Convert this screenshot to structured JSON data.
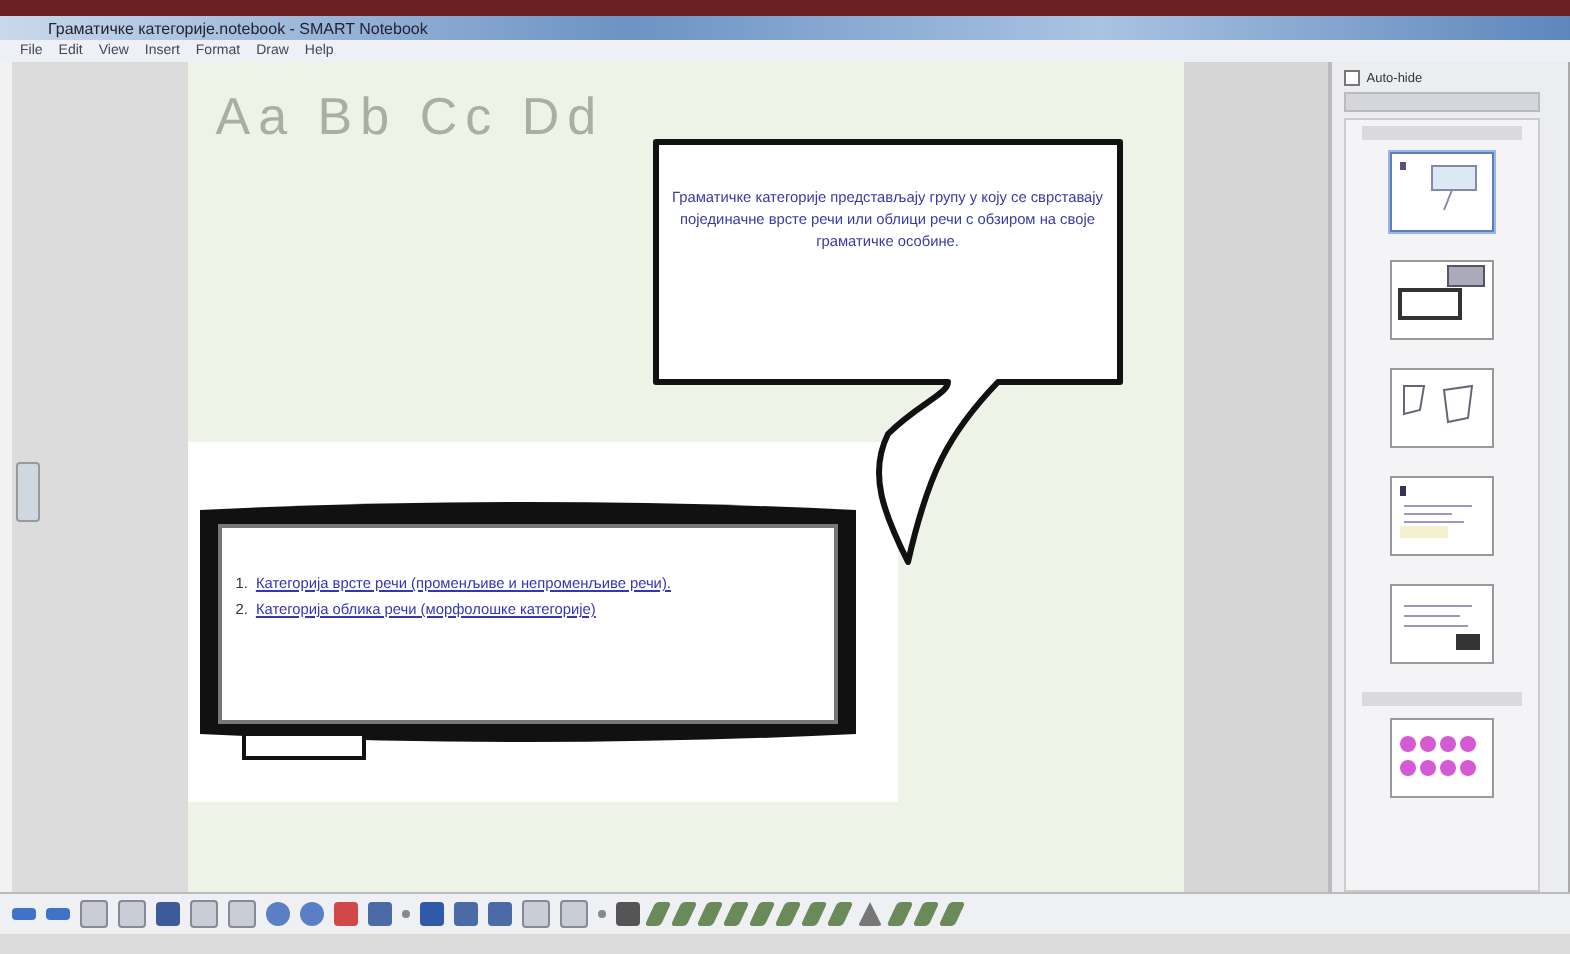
{
  "window": {
    "title": "Граматичке категорије.notebook - SMART Notebook"
  },
  "menu": [
    "File",
    "Edit",
    "View",
    "Insert",
    "Format",
    "Draw",
    "Help"
  ],
  "page": {
    "alphabet_strip": "Aa Bb Cc Dd",
    "callout": "Граматичке категорије представљају групу у коју се сврставају појединачне врсте речи или облици речи с обзиром на своје граматичке особине.",
    "list": [
      {
        "number": "1.",
        "text": "Категорија врсте речи (променљиве и непроменљиве речи)."
      },
      {
        "number": "2.",
        "text": "Категорија облика речи (морфолошке категорије)"
      }
    ]
  },
  "sidebar": {
    "auto_hide": {
      "label": "Auto-hide",
      "checked": false
    },
    "pages": [
      {
        "kind": "callout",
        "selected": true
      },
      {
        "kind": "frame",
        "selected": false
      },
      {
        "kind": "sketch",
        "selected": false
      },
      {
        "kind": "text",
        "selected": false
      },
      {
        "kind": "screen",
        "selected": false
      },
      {
        "kind": "dots",
        "selected": false
      }
    ]
  }
}
